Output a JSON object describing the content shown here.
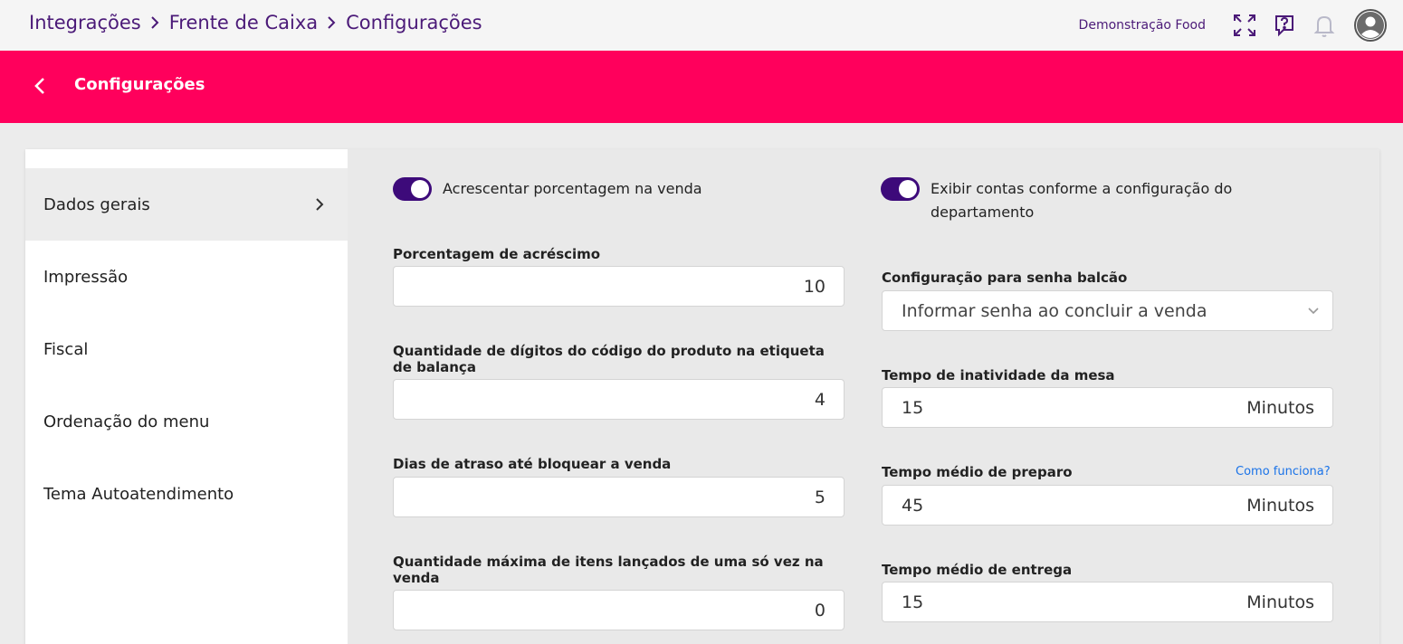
{
  "breadcrumb": [
    "Integrações",
    "Frente de Caixa",
    "Configurações"
  ],
  "header": {
    "org_name": "Demonstração Food",
    "icons": [
      "fullscreen-icon",
      "help-chat-icon",
      "bell-icon",
      "user-avatar-icon"
    ]
  },
  "page": {
    "title": "Configurações",
    "accent_color": "#ff005c",
    "toggle_color": "#3d0a7a"
  },
  "sidebar": {
    "items": [
      {
        "label": "Dados gerais",
        "active": true
      },
      {
        "label": "Impressão"
      },
      {
        "label": "Fiscal"
      },
      {
        "label": "Ordenação do menu"
      },
      {
        "label": "Tema Autoatendimento"
      }
    ]
  },
  "left": {
    "toggle_label": "Acrescentar porcentagem na venda",
    "toggle_on": true,
    "fields": [
      {
        "label": "Porcentagem de acréscimo",
        "value": "10"
      },
      {
        "label": "Quantidade de dígitos do código do produto na etiqueta de balança",
        "value": "4"
      },
      {
        "label": "Dias de atraso até bloquear a venda",
        "value": "5"
      },
      {
        "label": "Quantidade máxima de itens lançados de uma só vez na venda",
        "value": "0"
      }
    ]
  },
  "right": {
    "toggle_label": "Exibir contas conforme a configuração do departamento",
    "toggle_on": true,
    "select": {
      "label": "Configuração para senha balcão",
      "value": "Informar senha ao concluir a venda"
    },
    "fields": [
      {
        "label": "Tempo de inatividade da mesa",
        "value": "15",
        "suffix": "Minutos"
      },
      {
        "label": "Tempo médio de preparo",
        "value": "45",
        "suffix": "Minutos",
        "help_link": "Como funciona?"
      },
      {
        "label": "Tempo médio de entrega",
        "value": "15",
        "suffix": "Minutos"
      }
    ]
  }
}
